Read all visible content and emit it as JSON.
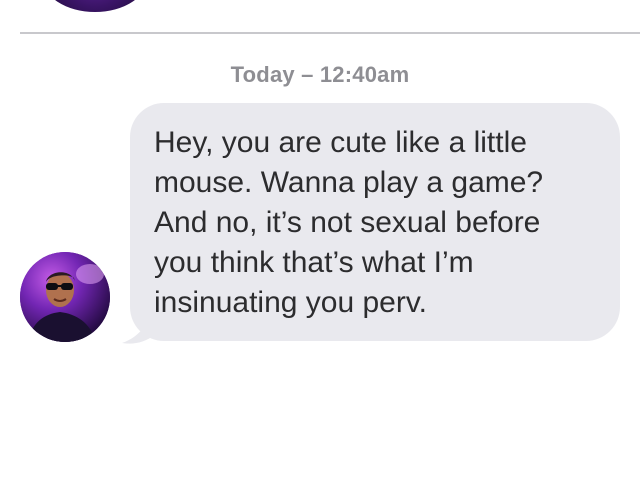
{
  "conversation": {
    "timestamp": "Today – 12:40am",
    "message": {
      "text": "Hey, you are cute like a little mouse. Wanna play a game? And no, it’s not sexual before you think that’s what I’m insinuating you perv."
    },
    "avatar_icon": "user-avatar-photo",
    "colors": {
      "bubble": "#e9e9ee",
      "timestamp": "#8e8e93",
      "text": "#2c2c2e",
      "divider": "#c8c8cc"
    }
  }
}
